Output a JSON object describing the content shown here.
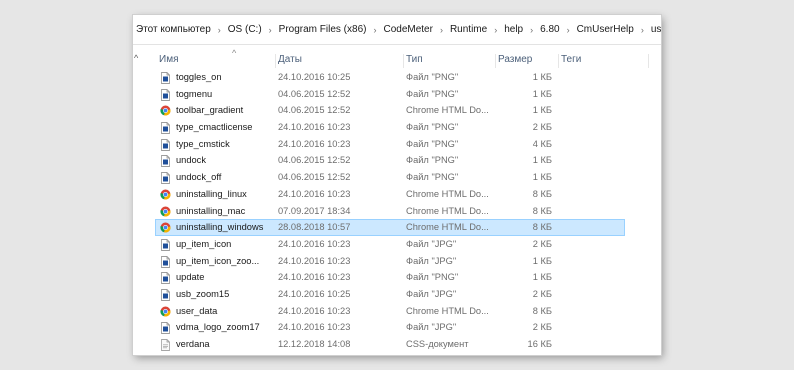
{
  "breadcrumb": [
    "Этот компьютер",
    "OS (C:)",
    "Program Files (x86)",
    "CodeMeter",
    "Runtime",
    "help",
    "6.80",
    "CmUserHelp",
    "us"
  ],
  "columns": {
    "name": "Имя",
    "date": "Даты",
    "type": "Тип",
    "size": "Размер",
    "tags": "Теги"
  },
  "collapse_glyph": "^",
  "sort_glyph": "^",
  "files": [
    {
      "name": "toggles_on",
      "date": "24.10.2016 10:25",
      "type": "Файл \"PNG\"",
      "size": "1 КБ",
      "icon": "png-file-icon"
    },
    {
      "name": "togmenu",
      "date": "04.06.2015 12:52",
      "type": "Файл \"PNG\"",
      "size": "1 КБ",
      "icon": "png-file-icon"
    },
    {
      "name": "toolbar_gradient",
      "date": "04.06.2015 12:52",
      "type": "Chrome HTML Do...",
      "size": "1 КБ",
      "icon": "chrome-icon"
    },
    {
      "name": "type_cmactlicense",
      "date": "24.10.2016 10:23",
      "type": "Файл \"PNG\"",
      "size": "2 КБ",
      "icon": "png-file-icon"
    },
    {
      "name": "type_cmstick",
      "date": "24.10.2016 10:23",
      "type": "Файл \"PNG\"",
      "size": "4 КБ",
      "icon": "png-file-icon"
    },
    {
      "name": "undock",
      "date": "04.06.2015 12:52",
      "type": "Файл \"PNG\"",
      "size": "1 КБ",
      "icon": "png-file-icon"
    },
    {
      "name": "undock_off",
      "date": "04.06.2015 12:52",
      "type": "Файл \"PNG\"",
      "size": "1 КБ",
      "icon": "png-file-icon"
    },
    {
      "name": "uninstalling_linux",
      "date": "24.10.2016 10:23",
      "type": "Chrome HTML Do...",
      "size": "8 КБ",
      "icon": "chrome-icon"
    },
    {
      "name": "uninstalling_mac",
      "date": "07.09.2017 18:34",
      "type": "Chrome HTML Do...",
      "size": "8 КБ",
      "icon": "chrome-icon"
    },
    {
      "name": "uninstalling_windows",
      "date": "28.08.2018 10:57",
      "type": "Chrome HTML Do...",
      "size": "8 КБ",
      "icon": "chrome-icon",
      "selected": true
    },
    {
      "name": "up_item_icon",
      "date": "24.10.2016 10:23",
      "type": "Файл \"JPG\"",
      "size": "2 КБ",
      "icon": "jpg-file-icon"
    },
    {
      "name": "up_item_icon_zoo...",
      "date": "24.10.2016 10:23",
      "type": "Файл \"JPG\"",
      "size": "1 КБ",
      "icon": "jpg-file-icon"
    },
    {
      "name": "update",
      "date": "24.10.2016 10:23",
      "type": "Файл \"PNG\"",
      "size": "1 КБ",
      "icon": "png-file-icon"
    },
    {
      "name": "usb_zoom15",
      "date": "24.10.2016 10:25",
      "type": "Файл \"JPG\"",
      "size": "2 КБ",
      "icon": "jpg-file-icon"
    },
    {
      "name": "user_data",
      "date": "24.10.2016 10:23",
      "type": "Chrome HTML Do...",
      "size": "8 КБ",
      "icon": "chrome-icon"
    },
    {
      "name": "vdma_logo_zoom17",
      "date": "24.10.2016 10:23",
      "type": "Файл \"JPG\"",
      "size": "2 КБ",
      "icon": "jpg-file-icon"
    },
    {
      "name": "verdana",
      "date": "12.12.2018 14:08",
      "type": "CSS-документ",
      "size": "16 КБ",
      "icon": "css-file-icon"
    }
  ],
  "colors": {
    "selected_bg": "#cce8ff",
    "selected_border": "#99d1ff",
    "header_text": "#4c607a"
  }
}
